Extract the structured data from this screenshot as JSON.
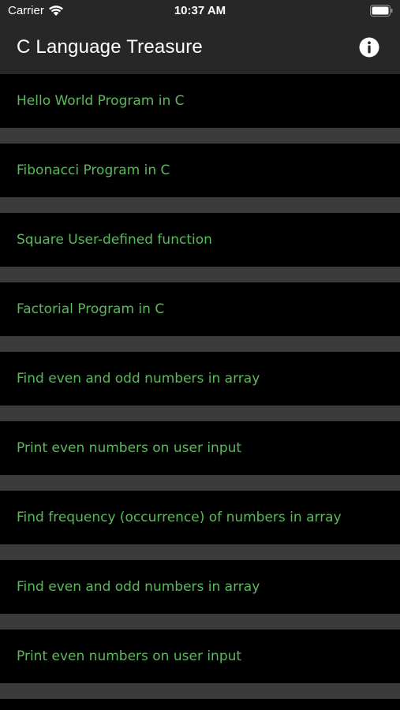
{
  "status_bar": {
    "carrier": "Carrier",
    "time": "10:37 AM"
  },
  "header": {
    "title": "C Language Treasure",
    "info_icon": "info-icon"
  },
  "list": {
    "items": [
      {
        "label": "Hello World Program in C"
      },
      {
        "label": "Fibonacci Program in C"
      },
      {
        "label": "Square User-defined function"
      },
      {
        "label": "Factorial Program in C"
      },
      {
        "label": "Find even and odd numbers in array"
      },
      {
        "label": "Print even numbers on user input"
      },
      {
        "label": "Find frequency (occurrence) of numbers in array"
      },
      {
        "label": "Find even and odd numbers in array"
      },
      {
        "label": "Print even numbers on user input"
      }
    ]
  },
  "colors": {
    "bar_background": "#272727",
    "list_text": "#5cb85c",
    "separator": "#3a3a3a",
    "background": "#000000"
  }
}
